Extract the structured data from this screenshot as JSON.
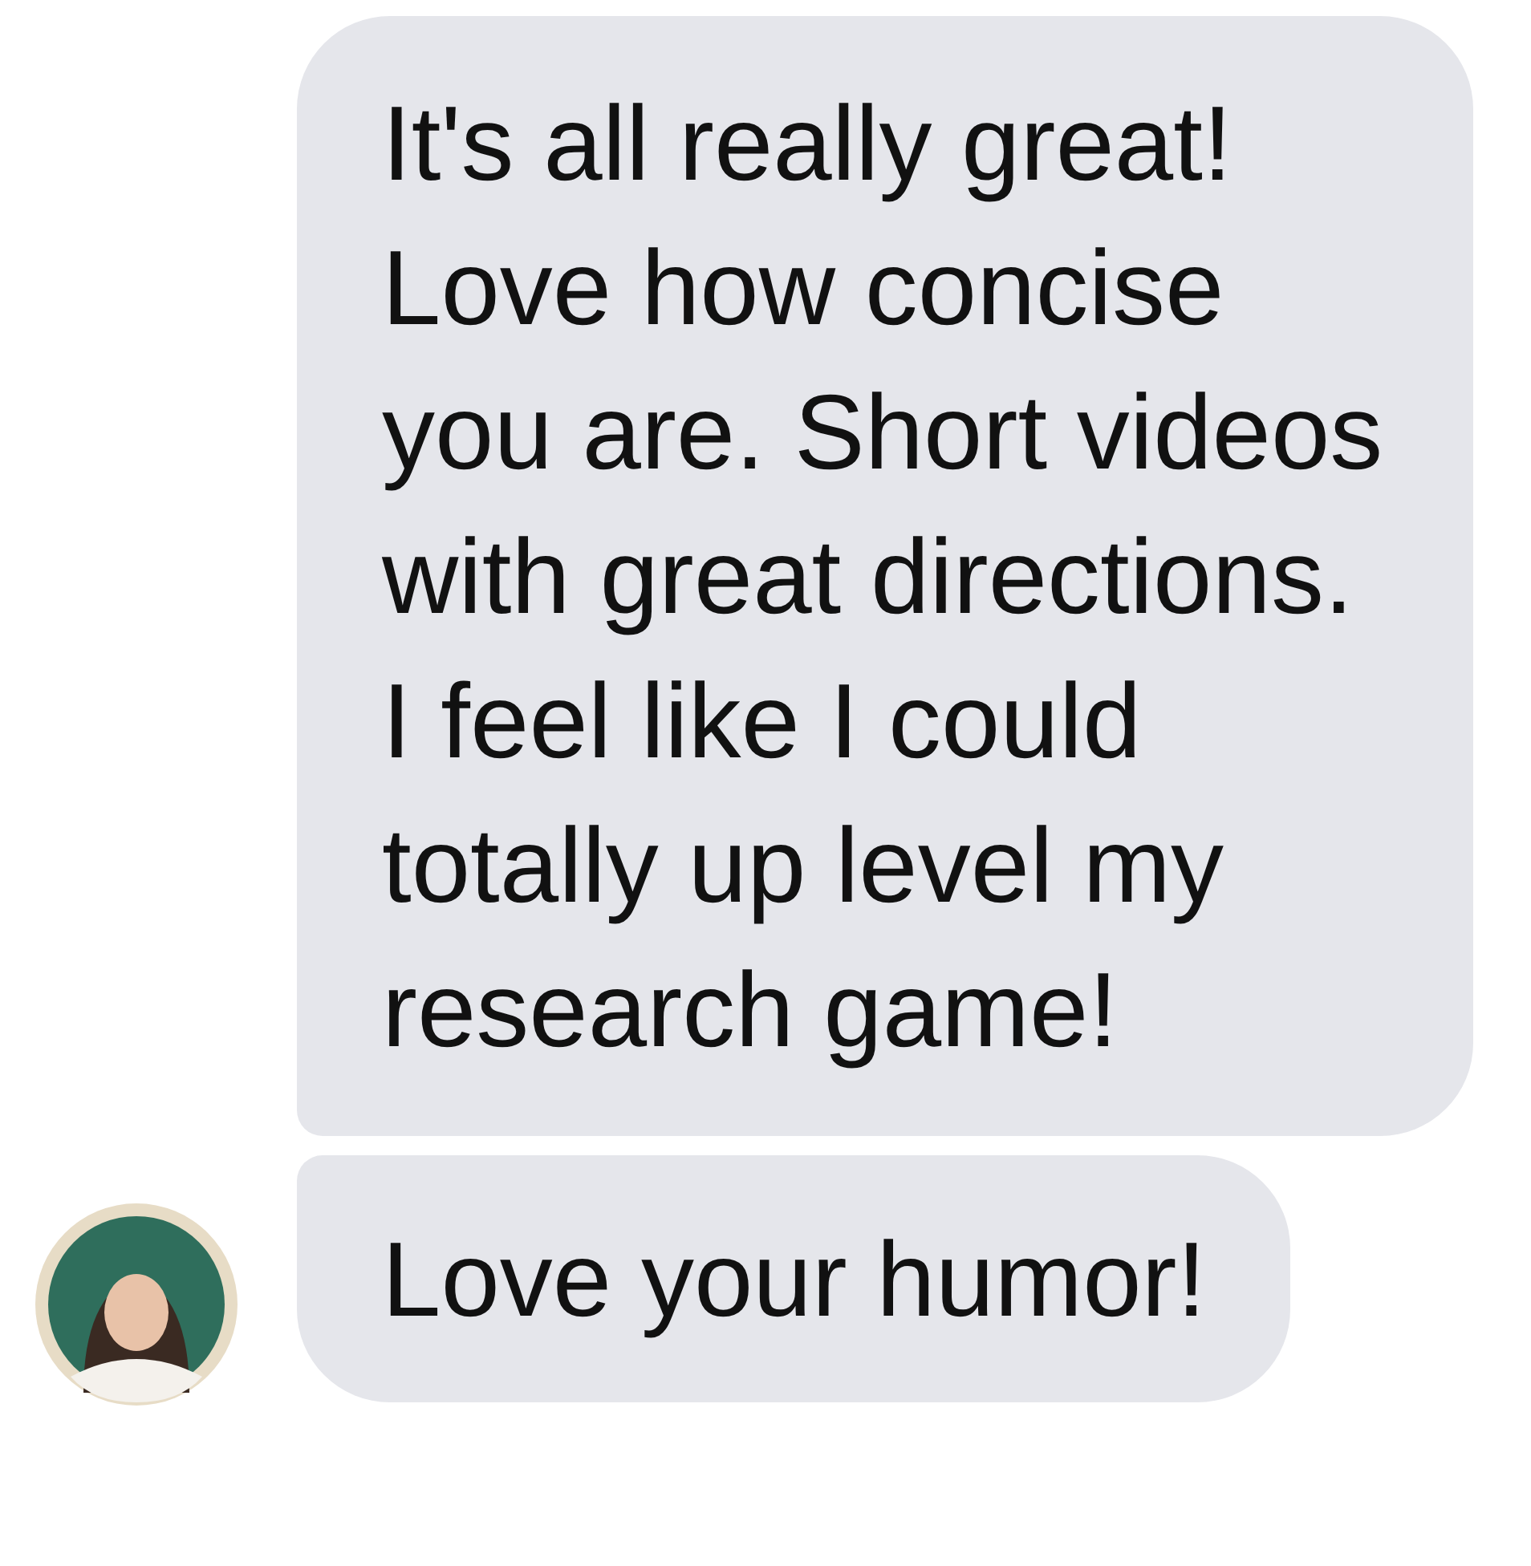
{
  "messages": [
    {
      "text": "It's all really great! Love how concise you are. Short videos with great directions. I feel like I could totally up level my research game!",
      "kind": "first",
      "show_avatar": false
    },
    {
      "text": "Love your humor!",
      "kind": "last",
      "show_avatar": true
    }
  ]
}
